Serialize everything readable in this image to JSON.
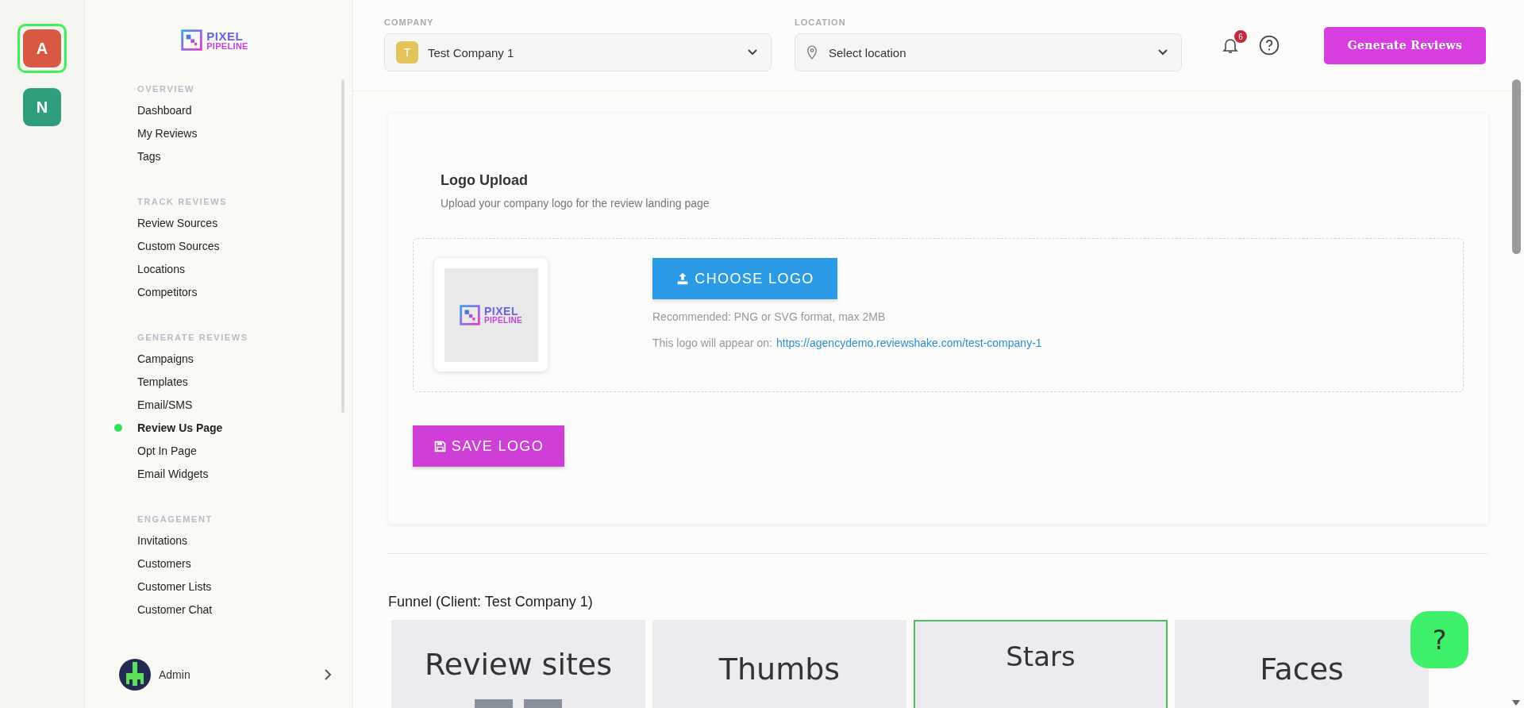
{
  "workspaces": [
    {
      "letter": "A",
      "color": "#d95843",
      "selected": true
    },
    {
      "letter": "N",
      "color": "#2f9e7f",
      "selected": false
    }
  ],
  "sidebar": {
    "logo": {
      "line_1": "PIXEL",
      "line_2": "PIPELINE"
    },
    "sections": [
      {
        "heading": "OVERVIEW",
        "items": [
          {
            "label": "Dashboard",
            "selected": false
          },
          {
            "label": "My Reviews",
            "selected": false
          },
          {
            "label": "Tags",
            "selected": false
          }
        ]
      },
      {
        "heading": "TRACK REVIEWS",
        "items": [
          {
            "label": "Review Sources",
            "selected": false
          },
          {
            "label": "Custom Sources",
            "selected": false
          },
          {
            "label": "Locations",
            "selected": false
          },
          {
            "label": "Competitors",
            "selected": false
          }
        ]
      },
      {
        "heading": "GENERATE REVIEWS",
        "items": [
          {
            "label": "Campaigns",
            "selected": false
          },
          {
            "label": "Templates",
            "selected": false
          },
          {
            "label": "Email/SMS",
            "selected": false
          },
          {
            "label": "Review Us Page",
            "selected": true
          },
          {
            "label": "Opt In Page",
            "selected": false
          },
          {
            "label": "Email Widgets",
            "selected": false
          }
        ]
      },
      {
        "heading": "ENGAGEMENT",
        "items": [
          {
            "label": "Invitations",
            "selected": false
          },
          {
            "label": "Customers",
            "selected": false
          },
          {
            "label": "Customer Lists",
            "selected": false
          },
          {
            "label": "Customer Chat",
            "selected": false
          }
        ]
      }
    ],
    "user": {
      "name": "Admin"
    }
  },
  "header": {
    "company": {
      "label": "COMPANY",
      "avatar": "T",
      "value": "Test Company 1"
    },
    "location": {
      "label": "LOCATION",
      "placeholder": "Select location"
    },
    "notifications": {
      "count": "6"
    },
    "generate_button": "Generate Reviews"
  },
  "logo_upload": {
    "title": "Logo Upload",
    "subtitle": "Upload your company logo for the review landing page",
    "preview_logo": {
      "line_1": "PIXEL",
      "line_2": "PIPELINE"
    },
    "choose_button": "CHOOSE LOGO",
    "hint": "Recommended: PNG or SVG format, max 2MB",
    "appear_text": "This logo will appear on:",
    "link": "https://agencydemo.reviewshake.com/test-company-1",
    "save_button": "SAVE LOGO"
  },
  "funnel": {
    "title": "Funnel (Client: Test Company 1)",
    "options": [
      {
        "label": "Review sites",
        "kind": "sites",
        "selected": false
      },
      {
        "label": "Thumbs",
        "kind": "thumbs",
        "selected": false
      },
      {
        "label": "Stars",
        "kind": "stars",
        "selected": true
      },
      {
        "label": "Faces",
        "kind": "faces",
        "selected": false
      }
    ]
  },
  "help_button": "?"
}
